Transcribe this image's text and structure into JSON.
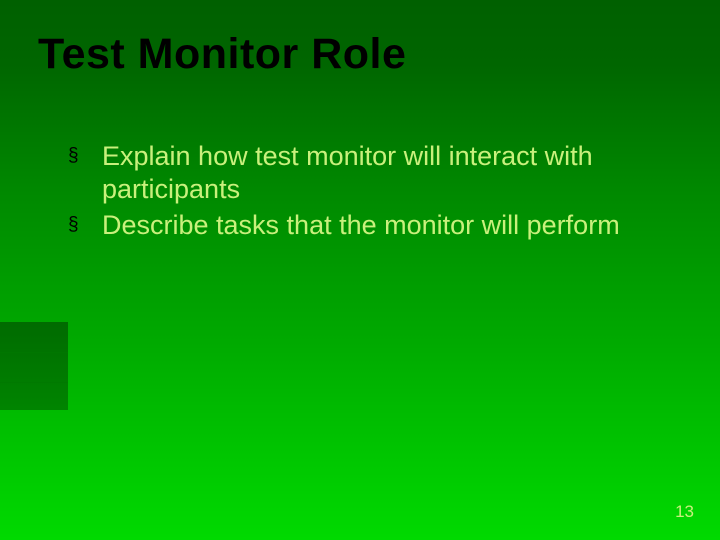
{
  "slide": {
    "title": "Test Monitor Role",
    "bullets": [
      "Explain how test monitor will interact with participants",
      "Describe tasks that the monitor will perform"
    ],
    "bullet_glyph": "§",
    "page_number": "13"
  }
}
